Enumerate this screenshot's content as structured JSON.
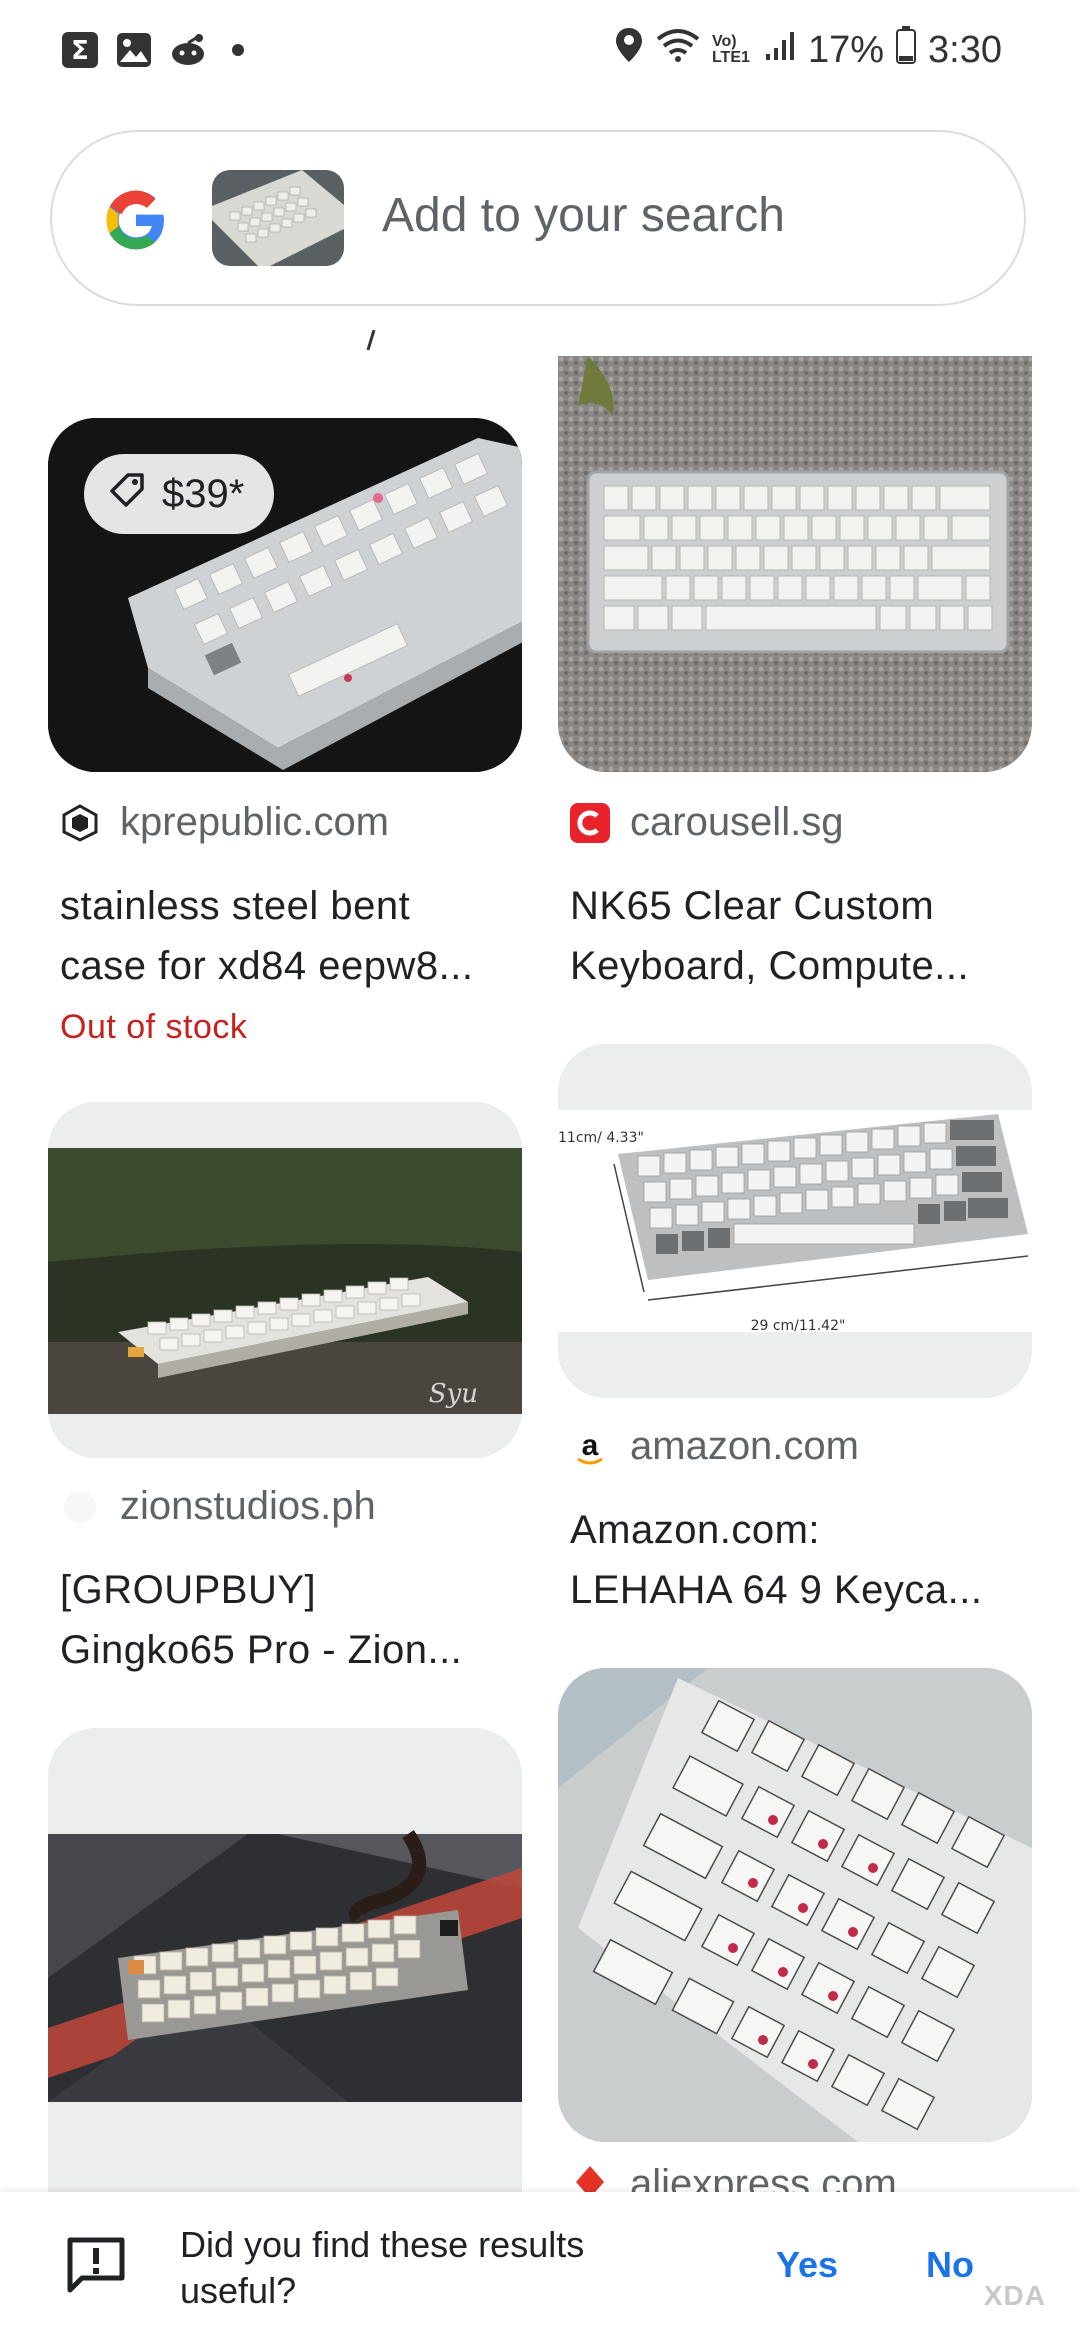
{
  "status_bar": {
    "battery": "17%",
    "time": "3:30",
    "network_label": "Vo) LTE1"
  },
  "search": {
    "placeholder": "Add to your search"
  },
  "results": [
    {
      "price": "$39*",
      "source": "kprepublic.com",
      "title_line1": "stainless steel bent",
      "title_line2": "case for xd84 eepw8...",
      "stock": "Out of stock"
    },
    {
      "source": "carousell.sg",
      "title_line1": "NK65 Clear Custom",
      "title_line2": "Keyboard, Compute..."
    },
    {
      "source": "zionstudios.ph",
      "title_line1": "[GROUPBUY]",
      "title_line2": "Gingko65 Pro - Zion..."
    },
    {
      "source": "amazon.com",
      "title_line1": "Amazon.com:",
      "title_line2": "LEHAHA 64 9 Keyca...",
      "image_text_dim1": "11cm/ 4.33\"",
      "image_text_dim2": "29 cm/11.42\""
    },
    {
      "source": "aliexpress.com"
    }
  ],
  "feedback": {
    "question_line1": "Did you find these results",
    "question_line2": "useful?",
    "yes": "Yes",
    "no": "No"
  },
  "watermark": "XDA",
  "colors": {
    "link_blue": "#1a73e8",
    "out_of_stock_red": "#c5221f",
    "muted_text": "#5f6368"
  }
}
